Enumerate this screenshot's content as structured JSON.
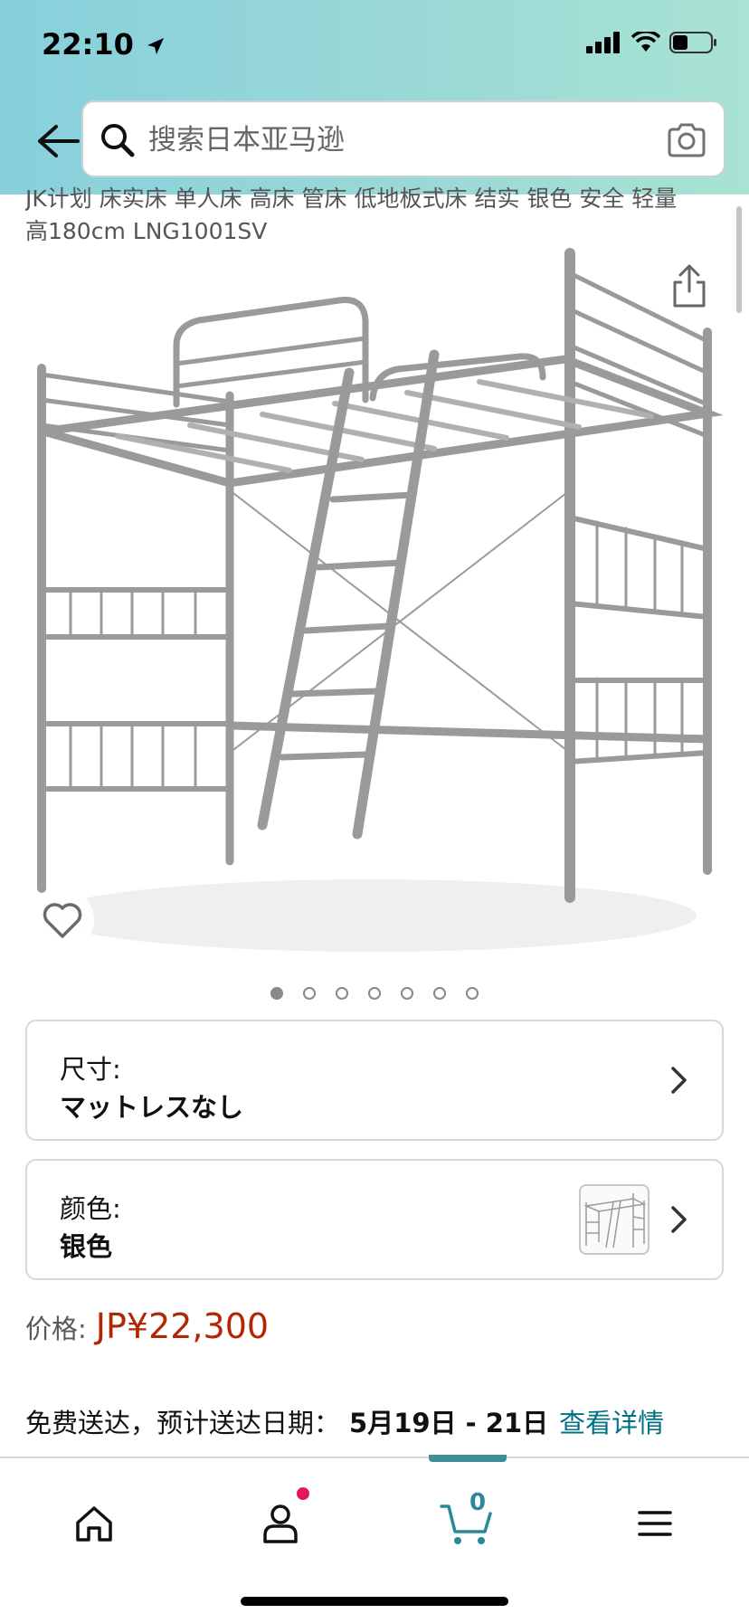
{
  "status_bar": {
    "time": "22:10"
  },
  "search": {
    "placeholder": "搜索日本亚马逊"
  },
  "product": {
    "title_line1": "JK计划 床实床 单人床 高床 管床 低地板式床 结实 银色 安全 轻量",
    "title_line2": "高180cm LNG1001SV",
    "image_count": 7,
    "active_image": 1
  },
  "options": {
    "size": {
      "label": "尺寸:",
      "value": "マットレスなし"
    },
    "color": {
      "label": "颜色:",
      "value": "银色"
    }
  },
  "price": {
    "label": "价格:",
    "value": "JP¥22,300"
  },
  "delivery": {
    "text": "免费送达，预计送达日期：",
    "date": "5月19日 - 21日",
    "link": "查看详情"
  },
  "nav": {
    "cart_count": "0"
  },
  "colors": {
    "price": "#b12704",
    "link": "#007185",
    "accent": "#3b8e9a",
    "badge": "#e0175e"
  }
}
